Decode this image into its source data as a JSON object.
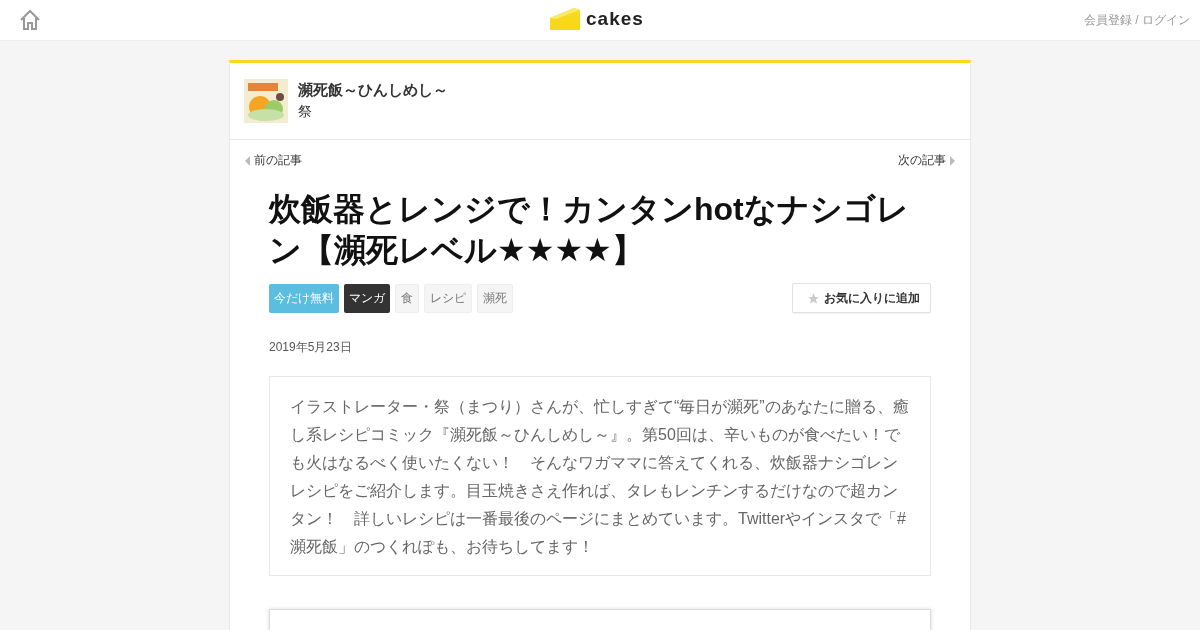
{
  "header": {
    "logo": "cakes",
    "auth_link": "会員登録 / ログイン"
  },
  "series": {
    "title": "瀕死飯～ひんしめし～",
    "author": "祭"
  },
  "nav": {
    "previous": "前の記事",
    "next": "次の記事"
  },
  "article": {
    "title": "炊飯器とレンジで！カンタンhotなナシゴレン【瀕死レベル★★★★】",
    "tags": [
      {
        "label": "今だけ無料",
        "kind": "free"
      },
      {
        "label": "マンガ",
        "kind": "category"
      },
      {
        "label": "食",
        "kind": "tag"
      },
      {
        "label": "レシピ",
        "kind": "tag"
      },
      {
        "label": "瀕死",
        "kind": "tag"
      }
    ],
    "favorite_button": "お気に入りに追加",
    "date": "2019年5月23日",
    "lead": "イラストレーター・祭（まつり）さんが、忙しすぎて“毎日が瀕死”のあなたに贈る、癒し系レシピコミック『瀕死飯～ひんしめし～』。第50回は、辛いものが食べたい！でも火はなるべく使いたくない！　そんなワガママに答えてくれる、炊飯器ナシゴレンレシピをご紹介します。目玉焼きさえ作れば、タレもレンチンするだけなので超カンタン！　詳しいレシピは一番最後のページにまとめています。Twitterやインスタで「#瀕死飯」のつくれぽも、お待ちしてます！"
  }
}
